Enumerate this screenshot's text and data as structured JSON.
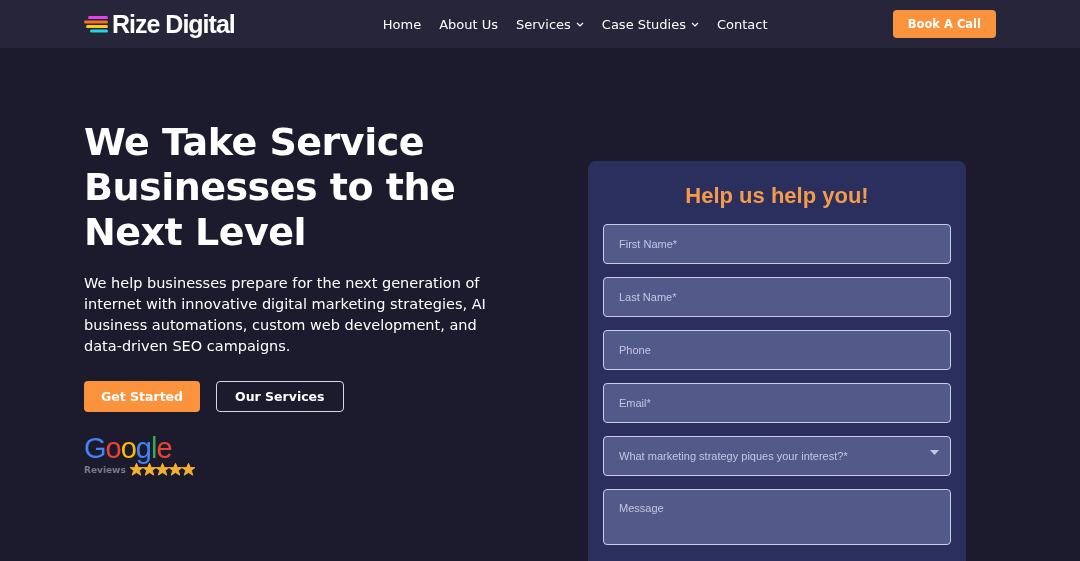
{
  "header": {
    "logo": "Rize Digital",
    "nav": [
      {
        "label": "Home",
        "dropdown": false
      },
      {
        "label": "About Us",
        "dropdown": false
      },
      {
        "label": "Services",
        "dropdown": true
      },
      {
        "label": "Case Studies",
        "dropdown": true
      },
      {
        "label": "Contact",
        "dropdown": false
      }
    ],
    "cta": "Book A Call"
  },
  "hero": {
    "heading": "We Take Service Businesses to the Next Level",
    "text": "We help businesses prepare for the next generation of internet with innovative digital marketing strategies, AI business automations, custom web development, and data-driven SEO campaigns.",
    "buttons": [
      {
        "label": "Get Started",
        "kind": "primary"
      },
      {
        "label": "Our Services",
        "kind": "outline"
      }
    ],
    "reviews": {
      "brand": "Google",
      "label": "Reviews",
      "stars": 5
    }
  },
  "form": {
    "title": "Help us help you!",
    "fields": [
      {
        "kind": "input",
        "placeholder": "First Name*"
      },
      {
        "kind": "input",
        "placeholder": "Last Name*"
      },
      {
        "kind": "input",
        "placeholder": "Phone"
      },
      {
        "kind": "input",
        "placeholder": "Email*"
      },
      {
        "kind": "select",
        "placeholder": "What marketing strategy piques your interest?*"
      },
      {
        "kind": "textarea",
        "placeholder": "Message"
      }
    ]
  }
}
